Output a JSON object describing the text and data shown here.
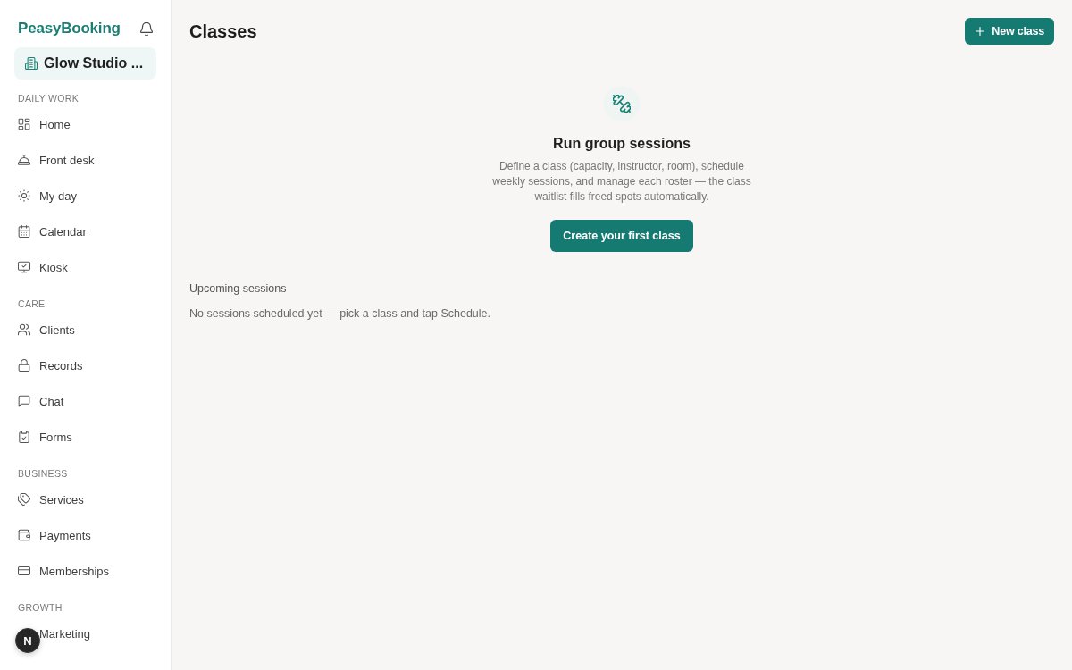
{
  "sidebar": {
    "brand": "PeasyBooking",
    "workspace": "Glow Studio ...",
    "sections": [
      {
        "title": "DAILY WORK",
        "items": [
          {
            "label": "Home",
            "selected": false
          },
          {
            "label": "Front desk",
            "selected": false
          },
          {
            "label": "My day",
            "selected": false
          },
          {
            "label": "Calendar",
            "selected": false
          },
          {
            "label": "Kiosk",
            "selected": false
          }
        ]
      },
      {
        "title": "CARE",
        "items": [
          {
            "label": "Clients",
            "selected": false
          },
          {
            "label": "Records",
            "selected": false
          },
          {
            "label": "Chat",
            "selected": false
          },
          {
            "label": "Forms",
            "selected": false
          }
        ]
      },
      {
        "title": "BUSINESS",
        "items": [
          {
            "label": "Services",
            "selected": false
          },
          {
            "label": "Payments",
            "selected": false
          },
          {
            "label": "Memberships",
            "selected": false
          }
        ]
      },
      {
        "title": "GROWTH",
        "items": [
          {
            "label": "Marketing",
            "selected": false
          }
        ]
      }
    ]
  },
  "header": {
    "title": "Classes",
    "primary_button": "New class"
  },
  "empty_state": {
    "title": "Run group sessions",
    "description": "Define a class (capacity, instructor, room), schedule weekly sessions, and manage each roster — the class waitlist fills freed spots automatically.",
    "button": "Create your first class"
  },
  "upcoming": {
    "title": "Upcoming sessions",
    "empty_text": "No sessions scheduled yet — pick a class and tap Schedule."
  },
  "dev_badge": "N"
}
